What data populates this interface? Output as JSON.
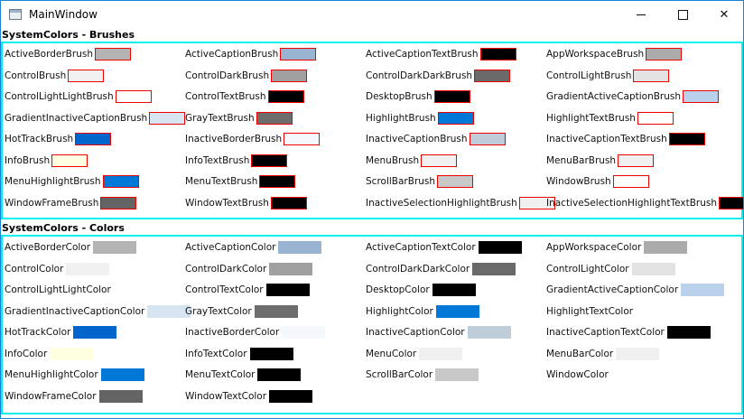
{
  "window": {
    "title": "MainWindow"
  },
  "controls": {
    "minimize": "",
    "maximize": "",
    "close": "✕"
  },
  "brushes": {
    "title": "SystemColors - Brushes",
    "items": [
      {
        "label": "ActiveBorderBrush",
        "color": "#b4b4b4"
      },
      {
        "label": "ActiveCaptionBrush",
        "color": "#99b4d1"
      },
      {
        "label": "ActiveCaptionTextBrush",
        "color": "#000000"
      },
      {
        "label": "AppWorkspaceBrush",
        "color": "#ababab"
      },
      {
        "label": "ControlBrush",
        "color": "#f0f0f0"
      },
      {
        "label": "ControlDarkBrush",
        "color": "#a0a0a0"
      },
      {
        "label": "ControlDarkDarkBrush",
        "color": "#696969"
      },
      {
        "label": "ControlLightBrush",
        "color": "#e3e3e3"
      },
      {
        "label": "ControlLightLightBrush",
        "color": "#ffffff"
      },
      {
        "label": "ControlTextBrush",
        "color": "#000000"
      },
      {
        "label": "DesktopBrush",
        "color": "#000000"
      },
      {
        "label": "GradientActiveCaptionBrush",
        "color": "#b9d1ea"
      },
      {
        "label": "GradientInactiveCaptionBrush",
        "color": "#d7e4f2"
      },
      {
        "label": "GrayTextBrush",
        "color": "#6d6d6d"
      },
      {
        "label": "HighlightBrush",
        "color": "#0078d7"
      },
      {
        "label": "HighlightTextBrush",
        "color": "#ffffff"
      },
      {
        "label": "HotTrackBrush",
        "color": "#0066cc"
      },
      {
        "label": "InactiveBorderBrush",
        "color": "#f4f7fc"
      },
      {
        "label": "InactiveCaptionBrush",
        "color": "#bfcddb"
      },
      {
        "label": "InactiveCaptionTextBrush",
        "color": "#000000"
      },
      {
        "label": "InfoBrush",
        "color": "#ffffe1"
      },
      {
        "label": "InfoTextBrush",
        "color": "#000000"
      },
      {
        "label": "MenuBrush",
        "color": "#f0f0f0"
      },
      {
        "label": "MenuBarBrush",
        "color": "#f0f0f0"
      },
      {
        "label": "MenuHighlightBrush",
        "color": "#0078d7"
      },
      {
        "label": "MenuTextBrush",
        "color": "#000000"
      },
      {
        "label": "ScrollBarBrush",
        "color": "#c8c8c8"
      },
      {
        "label": "WindowBrush",
        "color": "#ffffff"
      },
      {
        "label": "WindowFrameBrush",
        "color": "#646464"
      },
      {
        "label": "WindowTextBrush",
        "color": "#000000"
      },
      {
        "label": "InactiveSelectionHighlightBrush",
        "color": "#f0f0f0"
      },
      {
        "label": "InactiveSelectionHighlightTextBrush",
        "color": "#000000"
      }
    ]
  },
  "colors": {
    "title": "SystemColors - Colors",
    "items": [
      {
        "label": "ActiveBorderColor",
        "color": "#b4b4b4"
      },
      {
        "label": "ActiveCaptionColor",
        "color": "#99b4d1"
      },
      {
        "label": "ActiveCaptionTextColor",
        "color": "#000000"
      },
      {
        "label": "AppWorkspaceColor",
        "color": "#ababab"
      },
      {
        "label": "ControlColor",
        "color": "#f0f0f0"
      },
      {
        "label": "ControlDarkColor",
        "color": "#a0a0a0"
      },
      {
        "label": "ControlDarkDarkColor",
        "color": "#696969"
      },
      {
        "label": "ControlLightColor",
        "color": "#e3e3e3"
      },
      {
        "label": "ControlLightLightColor",
        "color": "#ffffff"
      },
      {
        "label": "ControlTextColor",
        "color": "#000000"
      },
      {
        "label": "DesktopColor",
        "color": "#000000"
      },
      {
        "label": "GradientActiveCaptionColor",
        "color": "#b9d1ea"
      },
      {
        "label": "GradientInactiveCaptionColor",
        "color": "#d7e4f2"
      },
      {
        "label": "GrayTextColor",
        "color": "#6d6d6d"
      },
      {
        "label": "HighlightColor",
        "color": "#0078d7"
      },
      {
        "label": "HighlightTextColor",
        "color": "#ffffff"
      },
      {
        "label": "HotTrackColor",
        "color": "#0066cc"
      },
      {
        "label": "InactiveBorderColor",
        "color": "#f4f7fc"
      },
      {
        "label": "InactiveCaptionColor",
        "color": "#bfcddb"
      },
      {
        "label": "InactiveCaptionTextColor",
        "color": "#000000"
      },
      {
        "label": "InfoColor",
        "color": "#ffffe1"
      },
      {
        "label": "InfoTextColor",
        "color": "#000000"
      },
      {
        "label": "MenuColor",
        "color": "#f0f0f0"
      },
      {
        "label": "MenuBarColor",
        "color": "#f0f0f0"
      },
      {
        "label": "MenuHighlightColor",
        "color": "#0078d7"
      },
      {
        "label": "MenuTextColor",
        "color": "#000000"
      },
      {
        "label": "ScrollBarColor",
        "color": "#c8c8c8"
      },
      {
        "label": "WindowColor",
        "color": "#ffffff"
      },
      {
        "label": "WindowFrameColor",
        "color": "#646464"
      },
      {
        "label": "WindowTextColor",
        "color": "#000000"
      }
    ]
  }
}
